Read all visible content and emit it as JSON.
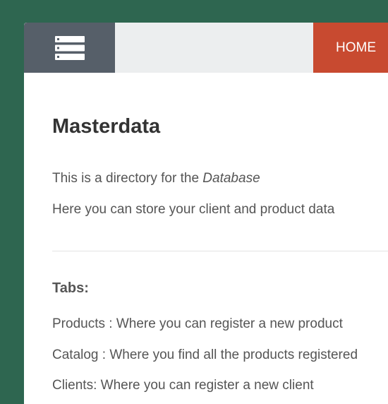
{
  "header": {
    "menu_icon": "server-stack-icon",
    "home_label": "HOME",
    "colors": {
      "background": "#2e6650",
      "menu_button": "#565f69",
      "home_button": "#c84a30",
      "topbar": "#eceeef"
    }
  },
  "main": {
    "title": "Masterdata",
    "intro_prefix": "This is a directory for the ",
    "intro_emphasis": "Database",
    "intro_line2": "Here you can store your client and product data",
    "tabs_heading": "Tabs:",
    "tabs": [
      {
        "text": "Products : Where you can register a new product"
      },
      {
        "text": "Catalog : Where you find all the products registered"
      },
      {
        "text": "Clients: Where you can register a new client"
      }
    ]
  }
}
